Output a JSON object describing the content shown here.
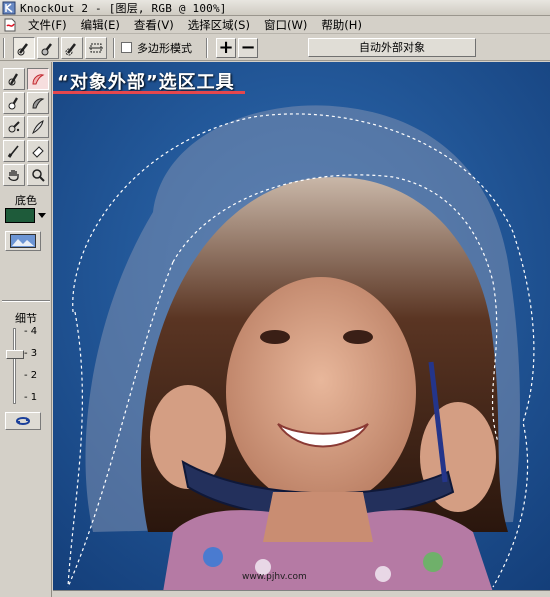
{
  "window": {
    "title": "KnockOut 2 - [图层, RGB @ 100%]",
    "menu": [
      {
        "label": "文件(F)"
      },
      {
        "label": "编辑(E)"
      },
      {
        "label": "查看(V)"
      },
      {
        "label": "选择区域(S)"
      },
      {
        "label": "窗口(W)"
      },
      {
        "label": "帮助(H)"
      }
    ]
  },
  "toolbar": {
    "polygon_mode_label": "多边形模式",
    "polygon_mode_checked": false,
    "add_label": "+",
    "subtract_label": "−",
    "auto_outside_label": "自动外部对象"
  },
  "palette": {
    "background_label": "底色",
    "background_color": "#1e5b3a",
    "detail_label": "细节",
    "detail_ticks": [
      "- 4",
      "- 3",
      "- 2",
      "- 1"
    ],
    "detail_value": 3
  },
  "canvas": {
    "overlay_label": "“对象外部”选区工具",
    "overlay_underline_color": "#e5474d",
    "watermark": "www.pjhv.com"
  }
}
